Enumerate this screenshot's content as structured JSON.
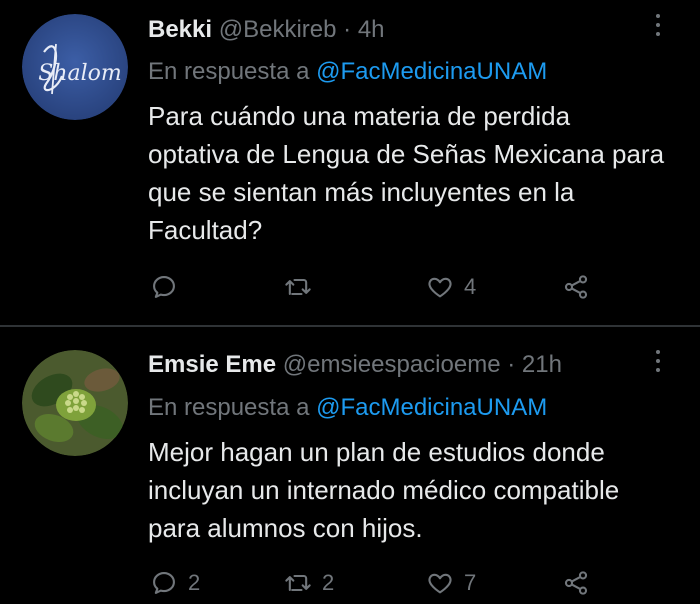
{
  "tweets": [
    {
      "name": "Bekki",
      "handle": "@Bekkireb",
      "separator": "·",
      "time": "4h",
      "reply_prefix": "En respuesta a",
      "reply_mention": "@FacMedicinaUNAM",
      "text": "Para cuándo una materia de perdida optativa de Lengua de Señas Mexicana para que se sientan más incluyentes en la Facultad?",
      "avatar_text": "Shalom",
      "counts": {
        "reply": "",
        "retweet": "",
        "like": "4"
      }
    },
    {
      "name": "Emsie Eme",
      "handle": "@emsieespacioeme",
      "separator": "·",
      "time": "21h",
      "reply_prefix": "En respuesta a",
      "reply_mention": "@FacMedicinaUNAM",
      "text": "Mejor hagan un plan de estudios donde incluyan un internado médico compatible para alumnos con hijos.",
      "counts": {
        "reply": "2",
        "retweet": "2",
        "like": "7"
      }
    }
  ],
  "icons": [
    "reply-icon",
    "retweet-icon",
    "like-icon",
    "share-icon",
    "more-icon"
  ],
  "colors": {
    "background": "#000000",
    "text": "#e7e9ea",
    "muted": "#71767b",
    "link": "#1d9bf0",
    "divider": "#2f3336"
  }
}
